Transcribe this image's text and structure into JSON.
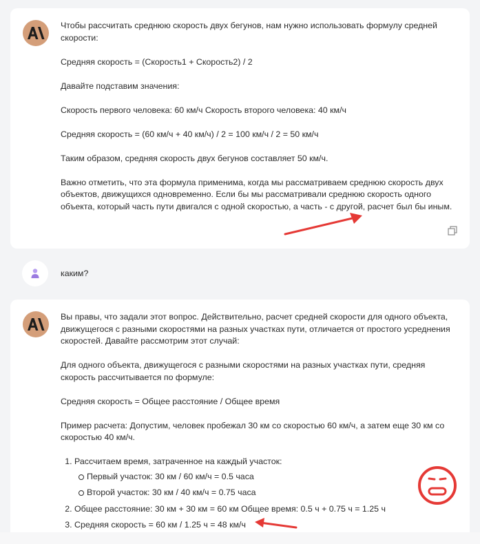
{
  "messages": [
    {
      "role": "assistant",
      "paragraphs": [
        "Чтобы рассчитать среднюю скорость двух бегунов, нам нужно использовать формулу средней скорости:",
        "Средняя скорость = (Скорость1 + Скорость2) / 2",
        "Давайте подставим значения:",
        "Скорость первого человека: 60 км/ч Скорость второго человека: 40 км/ч",
        "Средняя скорость = (60 км/ч + 40 км/ч) / 2 = 100 км/ч / 2 = 50 км/ч",
        "Таким образом, средняя скорость двух бегунов составляет 50 км/ч.",
        "Важно отметить, что эта формула применима, когда мы рассматриваем среднюю скорость двух объектов, движущихся одновременно. Если бы мы рассматривали среднюю скорость одного объекта, который часть пути двигался с одной скоростью, а часть - с другой, расчет был бы иным."
      ]
    },
    {
      "role": "user",
      "text": "каким?"
    },
    {
      "role": "assistant",
      "paragraphs": [
        "Вы правы, что задали этот вопрос. Действительно, расчет средней скорости для одного объекта, движущегося с разными скоростями на разных участках пути, отличается от простого усреднения скоростей. Давайте рассмотрим этот случай:",
        "Для одного объекта, движущегося с разными скоростями на разных участках пути, средняя скорость рассчитывается по формуле:",
        "Средняя скорость = Общее расстояние / Общее время",
        "Пример расчета: Допустим, человек пробежал 30 км со скоростью 60 км/ч, а затем еще 30 км со скоростью 40 км/ч."
      ],
      "list": {
        "item1": "Рассчитаем время, затраченное на каждый участок:",
        "sub1": "Первый участок: 30 км / 60 км/ч = 0.5 часа",
        "sub2": "Второй участок: 30 км / 40 км/ч = 0.75 часа",
        "item2": "Общее расстояние: 30 км + 30 км = 60 км Общее время: 0.5 ч + 0.75 ч = 1.25 ч",
        "item3": "Средняя скорость = 60 км / 1.25 ч = 48 км/ч"
      }
    }
  ],
  "icons": {
    "assistant_avatar": "anthropic-logo-icon",
    "user_avatar": "user-icon",
    "copy": "copy-icon"
  },
  "colors": {
    "assistant_avatar_bg": "#d49e79",
    "annotation_red": "#e53935",
    "user_icon": "#9b7be0"
  }
}
